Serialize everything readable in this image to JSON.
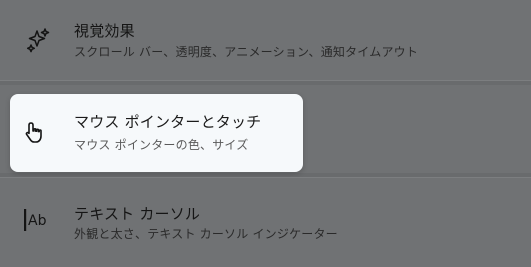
{
  "settings": {
    "items": [
      {
        "title": "視覚効果",
        "subtitle": "スクロール バー、透明度、アニメーション、通知タイムアウト",
        "icon": "sparkle-icon"
      },
      {
        "title": "マウス ポインターとタッチ",
        "subtitle": "マウス ポインターの色、サイズ",
        "icon": "pointer-hand-icon"
      },
      {
        "title": "テキスト カーソル",
        "subtitle": "外観と太さ、テキスト カーソル インジケーター",
        "icon": "text-cursor-icon"
      }
    ]
  },
  "colors": {
    "dim_overlay": "#696b6d",
    "card": "#707274",
    "highlight_card": "#f6f9fb",
    "text_primary": "#151515"
  }
}
